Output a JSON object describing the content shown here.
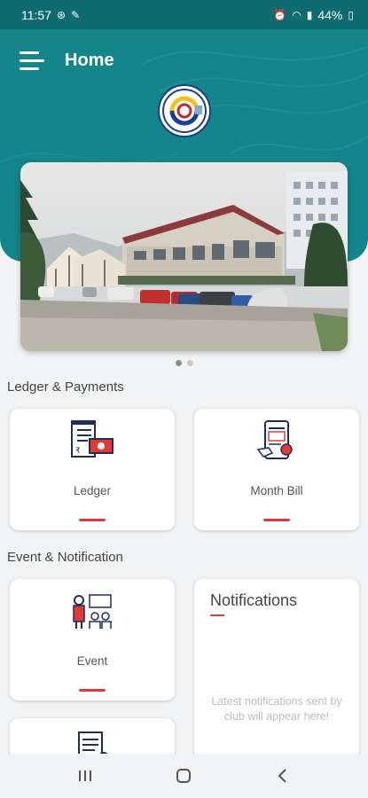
{
  "status_bar": {
    "time": "11:57",
    "battery": "44%"
  },
  "header": {
    "title": "Home"
  },
  "banner": {
    "slide_count": 2,
    "active_slide": 1
  },
  "sections": {
    "ledger": {
      "title": "Ledger & Payments",
      "cards": [
        {
          "label": "Ledger"
        },
        {
          "label": "Month Bill"
        }
      ]
    },
    "events": {
      "title": "Event & Notification",
      "event_label": "Event"
    }
  },
  "notifications": {
    "title": "Notifications",
    "empty_text": "Latest notifications sent by club will appear here!"
  },
  "colors": {
    "teal": "#14858a",
    "accent_red": "#e53935"
  }
}
